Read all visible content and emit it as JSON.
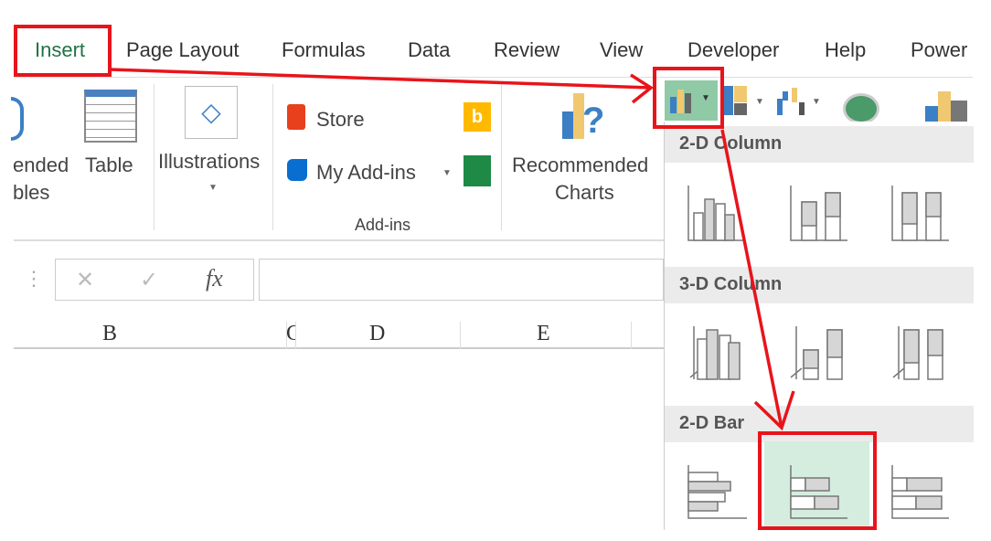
{
  "tabs": [
    "Insert",
    "Page Layout",
    "Formulas",
    "Data",
    "Review",
    "View",
    "Developer",
    "Help",
    "Power"
  ],
  "ribbon": {
    "recommended_pivot_partial": [
      "ended",
      "bles"
    ],
    "table": "Table",
    "illustrations": "Illustrations",
    "store": "Store",
    "my_addins": "My Add-ins",
    "addins_group": "Add-ins",
    "recommended_charts": [
      "Recommended",
      "Charts"
    ]
  },
  "formula_bar": {
    "fx": "fx",
    "cancel": "✕",
    "enter": "✓",
    "value": ""
  },
  "columns": [
    "B",
    "C",
    "D",
    "E"
  ],
  "dropdown": {
    "sections": [
      "2-D Column",
      "3-D Column",
      "2-D Bar"
    ]
  },
  "colors": {
    "annotation": "#e8141c",
    "highlight": "#d4eddf",
    "active_tab": "#217346"
  }
}
